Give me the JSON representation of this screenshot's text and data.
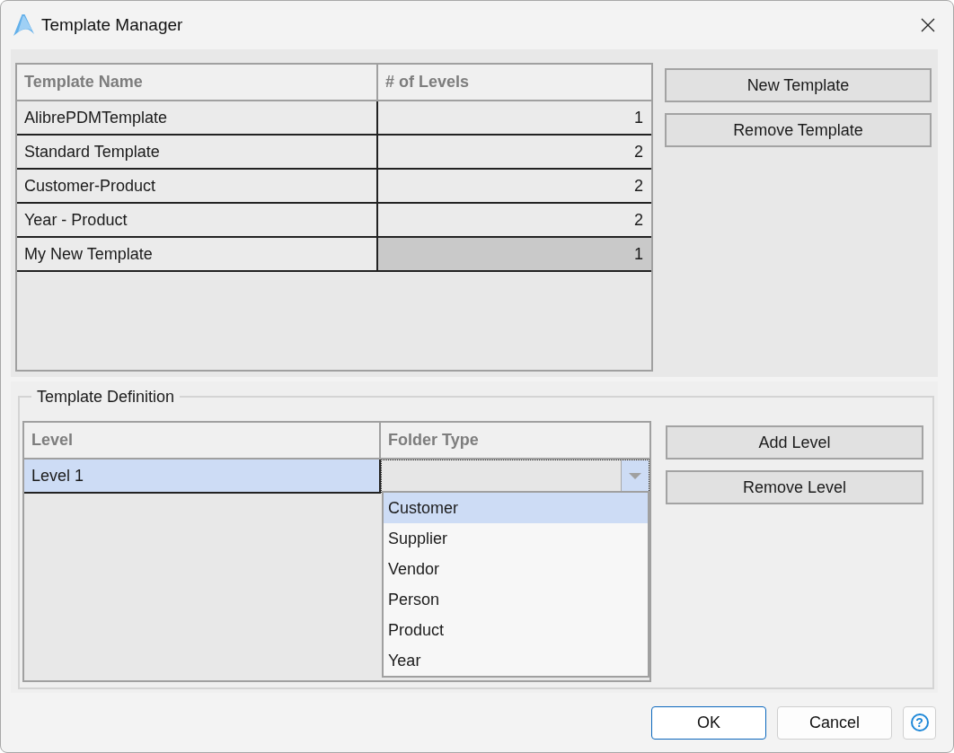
{
  "window": {
    "title": "Template Manager"
  },
  "templates": {
    "columns": [
      "Template Name",
      "# of Levels"
    ],
    "rows": [
      {
        "name": "AlibrePDMTemplate",
        "levels": "1",
        "selected": false
      },
      {
        "name": "Standard Template",
        "levels": "2",
        "selected": false
      },
      {
        "name": "Customer-Product",
        "levels": "2",
        "selected": false
      },
      {
        "name": "Year - Product",
        "levels": "2",
        "selected": false
      },
      {
        "name": "My New Template",
        "levels": "1",
        "selected": true
      }
    ]
  },
  "template_buttons": [
    {
      "label": "New Template"
    },
    {
      "label": "Remove Template"
    }
  ],
  "definition": {
    "title": "Template Definition",
    "columns": [
      "Level",
      "Folder Type"
    ],
    "rows": [
      {
        "level": "Level 1",
        "selected": true,
        "folder_type": {
          "expanded": true,
          "options": [
            {
              "label": "Customer",
              "selected": true
            },
            {
              "label": "Supplier",
              "selected": false
            },
            {
              "label": "Vendor",
              "selected": false
            },
            {
              "label": "Person",
              "selected": false
            },
            {
              "label": "Product",
              "selected": false
            },
            {
              "label": "Year",
              "selected": false
            }
          ]
        }
      }
    ]
  },
  "level_buttons": [
    {
      "label": "Add Level"
    },
    {
      "label": "Remove Level"
    }
  ],
  "footer_buttons": [
    {
      "kind": "default",
      "label": "OK"
    },
    {
      "kind": "normal",
      "label": "Cancel"
    },
    {
      "kind": "help",
      "label": "?"
    }
  ]
}
